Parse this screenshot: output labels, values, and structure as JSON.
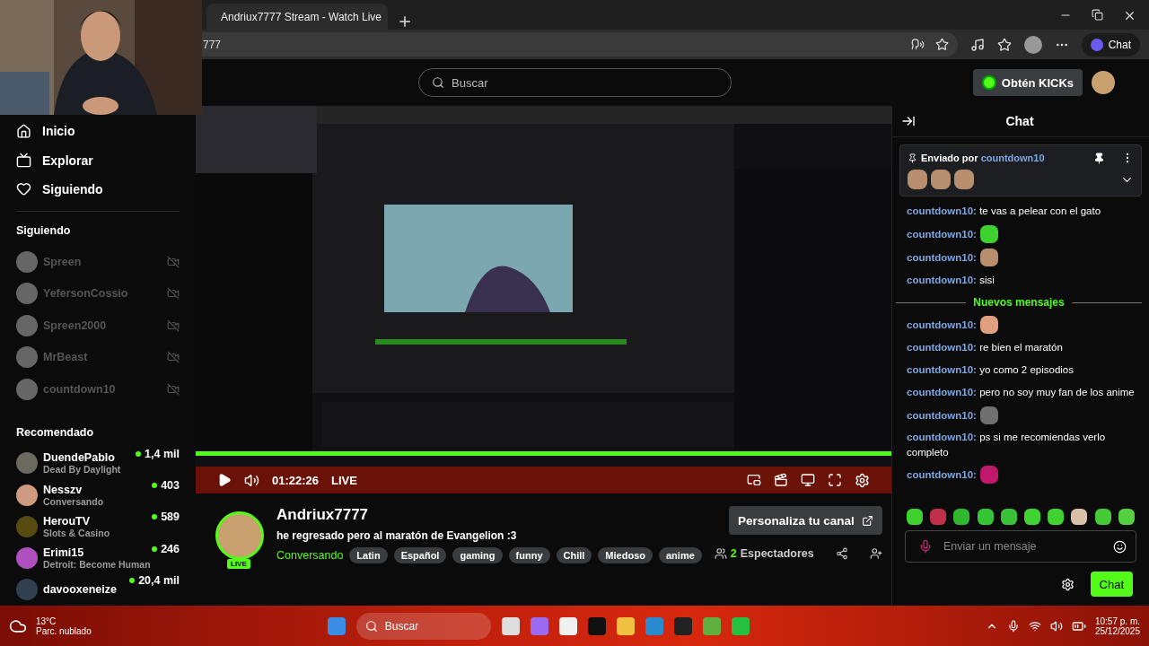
{
  "browser": {
    "tab_title": "Andriux7777 Stream - Watch Live",
    "address": "777",
    "chat_button": "Chat"
  },
  "header": {
    "search_placeholder": "Buscar",
    "kicks_button": "Obtén KICKs"
  },
  "sidebar": {
    "nav": [
      {
        "label": "Inicio",
        "kind": "home"
      },
      {
        "label": "Explorar",
        "kind": "explore"
      },
      {
        "label": "Siguiendo",
        "kind": "following"
      }
    ],
    "following_title": "Siguiendo",
    "following": [
      {
        "name": "Spreen",
        "offline": true
      },
      {
        "name": "YefersonCossio",
        "offline": true
      },
      {
        "name": "Spreen2000",
        "offline": true
      },
      {
        "name": "MrBeast",
        "offline": true
      },
      {
        "name": "countdown10",
        "offline": true
      }
    ],
    "recommended_title": "Recomendado",
    "recommended": [
      {
        "name": "DuendePablo",
        "category": "Dead By Daylight",
        "viewers": "1,4 mil"
      },
      {
        "name": "Nesszv",
        "category": "Conversando",
        "viewers": "403"
      },
      {
        "name": "HerouTV",
        "category": "Slots & Casino",
        "viewers": "589"
      },
      {
        "name": "Erimi15",
        "category": "Detroit: Become Human",
        "viewers": "246"
      },
      {
        "name": "davooxeneize",
        "viewers": "20,4 mil"
      }
    ]
  },
  "player": {
    "time": "01:22:26",
    "live": "LIVE"
  },
  "stream": {
    "channel": "Andriux7777",
    "live_badge": "LIVE",
    "title": "he regresado pero al maratón de Evangelion :3",
    "category": "Conversando",
    "tags": [
      "Latin",
      "Español",
      "gaming",
      "funny",
      "Chill",
      "Miedoso",
      "anime"
    ],
    "customize_button": "Personaliza tu canal",
    "viewers": "2",
    "viewers_label": "Espectadores"
  },
  "chat": {
    "title": "Chat",
    "pinned": {
      "label": "Enviado por",
      "user": "countdown10",
      "emotes": [
        {
          "color": "#b88f6e"
        },
        {
          "color": "#b88f6e"
        },
        {
          "color": "#b88f6e"
        }
      ]
    },
    "messages": [
      {
        "kind": "text",
        "user": "countdown10:",
        "text": "te vas a pelear con el gato"
      },
      {
        "kind": "emote",
        "user": "countdown10:",
        "color": "#3fd12f"
      },
      {
        "kind": "emote",
        "user": "countdown10:",
        "color": "#b88f6e"
      },
      {
        "kind": "text",
        "user": "countdown10:",
        "text": "sisi"
      },
      {
        "kind": "divider",
        "text": "Nuevos mensajes"
      },
      {
        "kind": "emote",
        "user": "countdown10:",
        "color": "#e0a080"
      },
      {
        "kind": "text",
        "user": "countdown10:",
        "text": "re bien el maratón"
      },
      {
        "kind": "text",
        "user": "countdown10:",
        "text": "yo como 2 episodios"
      },
      {
        "kind": "text",
        "user": "countdown10:",
        "text": "pero no soy muy fan de los anime"
      },
      {
        "kind": "emote",
        "user": "countdown10:",
        "color": "#707070"
      },
      {
        "kind": "text",
        "user": "countdown10:",
        "text": "ps si me recomiendas verlo completo"
      },
      {
        "kind": "emote",
        "user": "countdown10:",
        "color": "#c0186a"
      }
    ],
    "emote_bar": [
      {
        "color": "#3fd12f"
      },
      {
        "color": "#c0304a"
      },
      {
        "color": "#2fb82f"
      },
      {
        "color": "#35c535"
      },
      {
        "color": "#3ac23a"
      },
      {
        "color": "#41d333"
      },
      {
        "color": "#3fd12f"
      },
      {
        "color": "#d9c0a8"
      },
      {
        "color": "#46c936"
      },
      {
        "color": "#54d040"
      }
    ],
    "input_placeholder": "Enviar un mensaje",
    "send_button": "Chat"
  },
  "taskbar": {
    "temperature": "13°C",
    "weather": "Parc. nublado",
    "search": "Buscar",
    "time": "10:57 p. m.",
    "date": "25/12/2025"
  }
}
